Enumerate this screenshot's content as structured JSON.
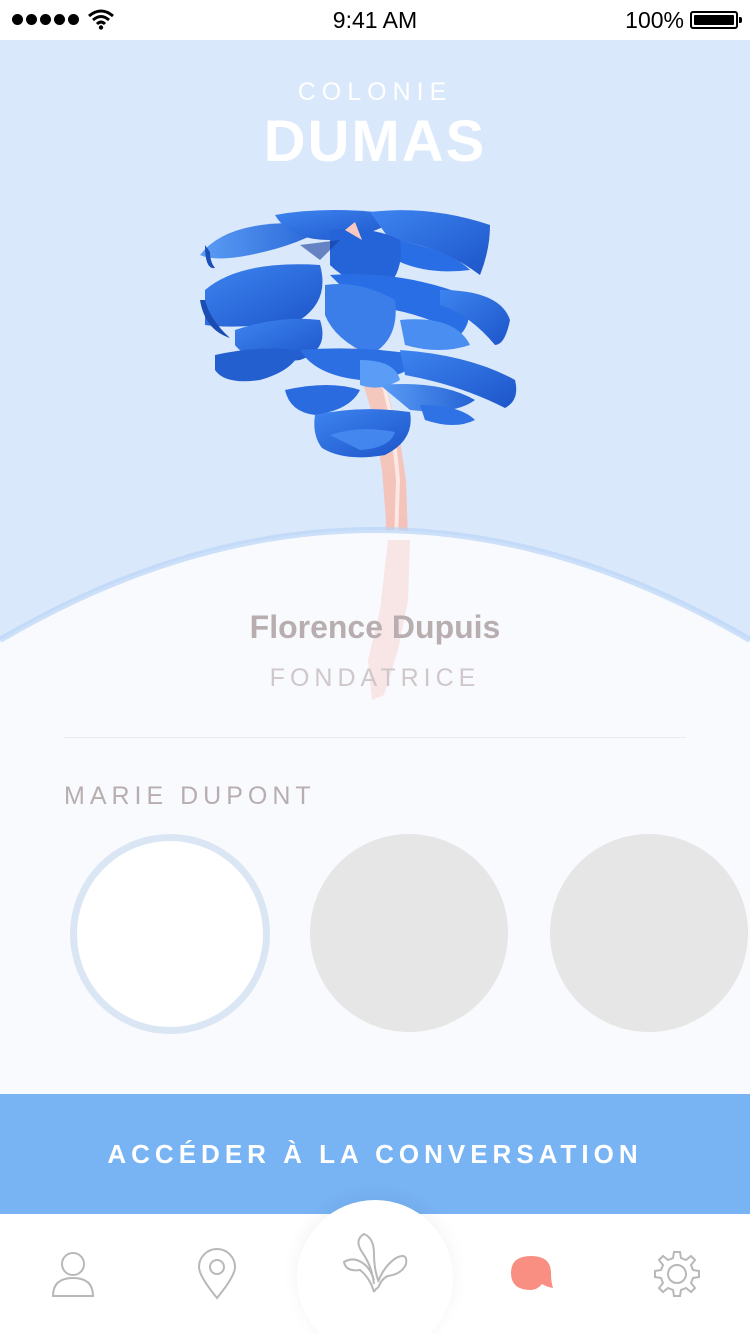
{
  "status_bar": {
    "time": "9:41 AM",
    "battery_percent": "100%",
    "signal_bars": 5,
    "icons": [
      "signal-dots-icon",
      "wifi-icon",
      "battery-icon"
    ]
  },
  "colony": {
    "label": "COLONIE",
    "name": "DUMAS",
    "illustration": "tree-icon"
  },
  "owner": {
    "name": "Florence Dupuis",
    "role": "FONDATRICE"
  },
  "members": {
    "label": "MARIE DUPONT",
    "items": [
      {
        "state": "selected"
      },
      {
        "state": "placeholder"
      },
      {
        "state": "placeholder"
      }
    ]
  },
  "cta": {
    "label": "ACCÉDER À LA CONVERSATION"
  },
  "tab_bar": {
    "items": [
      {
        "icon": "profile-icon",
        "active": false
      },
      {
        "icon": "location-pin-icon",
        "active": false
      },
      {
        "icon": "plant-icon",
        "active": false
      },
      {
        "icon": "chat-bubble-icon",
        "active": true
      },
      {
        "icon": "settings-gear-icon",
        "active": false
      }
    ]
  },
  "colors": {
    "hero_background": "#d9e8fb",
    "card_background": "#f8fafd",
    "cta_background": "#78b3f4",
    "leaf_blue": "#2b6fe3",
    "trunk_pink": "#f6c7bf",
    "active_tab": "#f98e82",
    "inactive_tab": "#b8b8b8",
    "placeholder_circle": "#e6e6e6",
    "selected_ring": "#dae6f3"
  }
}
